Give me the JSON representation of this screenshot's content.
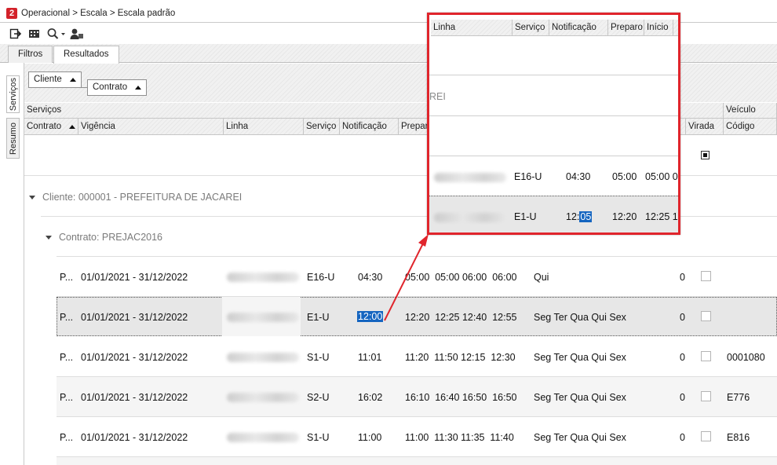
{
  "titlebar": {
    "app_icon_glyph": "2",
    "breadcrumb": "Operacional > Escala > Escala padrão"
  },
  "toolbar": {
    "icons": [
      "export-icon",
      "film-icon",
      "search-icon",
      "user-icon"
    ]
  },
  "tabs": {
    "filtros": "Filtros",
    "resultados": "Resultados"
  },
  "side_tabs": {
    "servicos": "Serviços",
    "resumo": "Resumo"
  },
  "grouping": {
    "cliente": "Cliente",
    "contrato": "Contrato"
  },
  "bands": {
    "servicos": "Serviços",
    "veiculo": "Veículo"
  },
  "columns": {
    "contrato": "Contrato",
    "vigencia": "Vigência",
    "linha": "Linha",
    "servico": "Serviço",
    "notificacao": "Notificação",
    "preparo": "Prepar",
    "virada": "Virada",
    "codigo": "Código"
  },
  "groups": {
    "cliente": "Cliente: 000001 - PREFEITURA DE JACAREI",
    "contrato": "Contrato: PREJAC2016"
  },
  "rows": [
    {
      "contrato": "P...",
      "vigencia": "01/01/2021 - 31/12/2022",
      "servico": "E16-U",
      "notificacao": "04:30",
      "times": "05:00  05:00 06:00  06:00",
      "dias": "Qui",
      "virada_val": "0",
      "codigo": ""
    },
    {
      "contrato": "P...",
      "vigencia": "01/01/2021 - 31/12/2022",
      "servico": "E1-U",
      "notificacao": "12:00",
      "times": "12:20  12:25 12:40  12:55",
      "dias": "Seg Ter Qua Qui Sex",
      "virada_val": "0",
      "codigo": ""
    },
    {
      "contrato": "P...",
      "vigencia": "01/01/2021 - 31/12/2022",
      "servico": "S1-U",
      "notificacao": "11:01",
      "times": "11:20  11:50 12:15  12:30",
      "dias": "Seg Ter Qua Qui Sex",
      "virada_val": "0",
      "codigo": "0001080"
    },
    {
      "contrato": "P...",
      "vigencia": "01/01/2021 - 31/12/2022",
      "servico": "S2-U",
      "notificacao": "16:02",
      "times": "16:10  16:40 16:50  16:50",
      "dias": "Seg Ter Qua Qui Sex",
      "virada_val": "0",
      "codigo": "E776"
    },
    {
      "contrato": "P...",
      "vigencia": "01/01/2021 - 31/12/2022",
      "servico": "S1-U",
      "notificacao": "11:00",
      "times": "11:00  11:30 11:35  11:40",
      "dias": "Seg Ter Qua Qui Sex",
      "virada_val": "0",
      "codigo": "E816"
    }
  ],
  "zoom": {
    "columns": {
      "linha": "Linha",
      "servico": "Serviço",
      "notificacao": "Notificação",
      "preparo": "Preparo",
      "inicio": "Início"
    },
    "group_fragment": "REI",
    "row1": {
      "servico": "E16-U",
      "notificacao": "04:30",
      "preparo": "05:00",
      "inicio": "05:00 0"
    },
    "row2": {
      "servico": "E1-U",
      "notificacao_prefix": "12:",
      "notificacao_selected": "05",
      "preparo": "12:20",
      "inicio": "12:25 1"
    }
  },
  "colors": {
    "brand": "#d3222a",
    "selection": "#1565c0",
    "highlight_border": "#e0252c",
    "arrow": "#e0252c"
  }
}
